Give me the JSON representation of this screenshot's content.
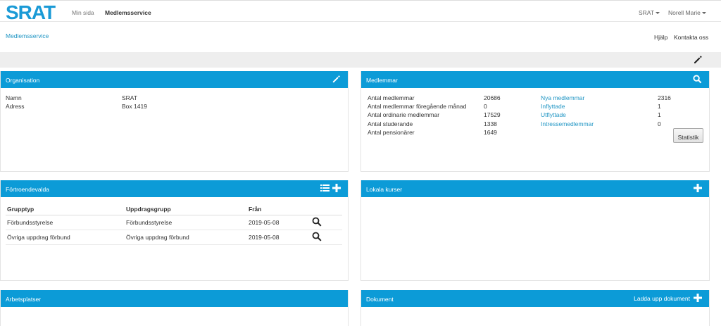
{
  "brand": {
    "logo_text": "SRAT",
    "color": "#1a9ad6"
  },
  "nav": {
    "my_page": "Min sida",
    "member_service": "Medlemsservice"
  },
  "user_menu": {
    "org": "SRAT",
    "user": "Norell Marie"
  },
  "breadcrumb": "Medlemsservice",
  "top_links": {
    "help": "Hjälp",
    "contact": "Kontakta oss"
  },
  "organisation": {
    "title": "Organisation",
    "name_label": "Namn",
    "name_value": "SRAT",
    "address_label": "Adress",
    "address_value": "Box 1419"
  },
  "members": {
    "title": "Medlemmar",
    "rows": [
      {
        "label": "Antal medlemmar",
        "value": "20686"
      },
      {
        "label": "Antal medlemmar föregående månad",
        "value": "0"
      },
      {
        "label": "Antal ordinarie medlemmar",
        "value": "17529"
      },
      {
        "label": "Antal studerande",
        "value": "1338"
      },
      {
        "label": "Antal pensionärer",
        "value": "1649"
      }
    ],
    "links": [
      {
        "label": "Nya medlemmar",
        "value": "2316"
      },
      {
        "label": "Inflyttade",
        "value": "1"
      },
      {
        "label": "Utflyttade",
        "value": "1"
      },
      {
        "label": "Intressemedlemmar",
        "value": "0"
      }
    ],
    "stats_button": "Statistik"
  },
  "trustees": {
    "title": "Förtroendevalda",
    "columns": [
      "Grupptyp",
      "Uppdragsgrupp",
      "Från"
    ],
    "rows": [
      {
        "type": "Förbundsstyrelse",
        "group": "Förbundsstyrelse",
        "from": "2019-05-08"
      },
      {
        "type": "Övriga uppdrag förbund",
        "group": "Övriga uppdrag förbund",
        "from": "2019-05-08"
      }
    ]
  },
  "courses": {
    "title": "Lokala kurser"
  },
  "workplaces": {
    "title": "Arbetsplatser"
  },
  "documents": {
    "title": "Dokument",
    "upload_label": "Ladda upp dokument"
  },
  "icons": {
    "edit": "pencil-icon",
    "search": "magnifier-icon",
    "add": "plus-icon",
    "list": "list-icon"
  },
  "colors": {
    "panel_header": "#0c9bd7",
    "link": "#2196c4",
    "gray_bar": "#eeeeee"
  }
}
